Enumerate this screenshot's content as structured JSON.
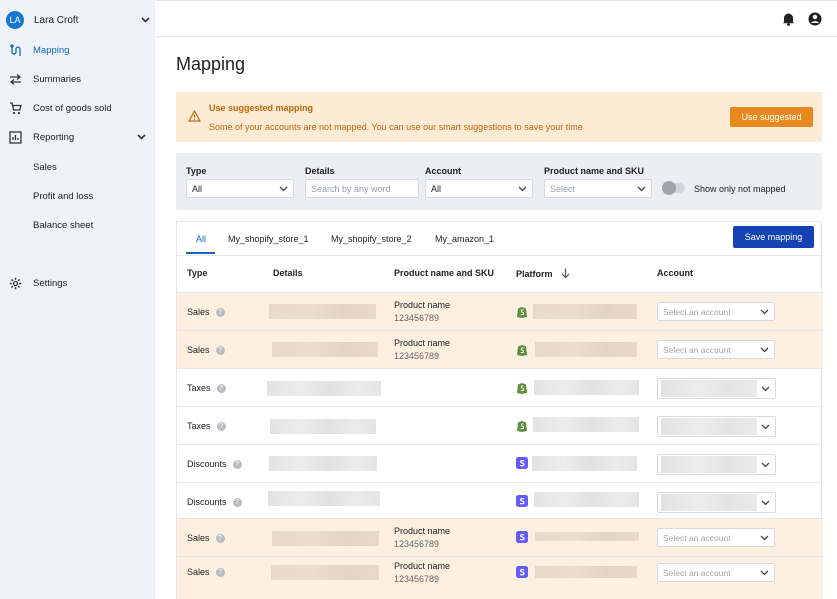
{
  "user": {
    "initials": "LA",
    "name": "Lara Croft"
  },
  "nav": {
    "mapping": "Mapping",
    "summaries": "Summaries",
    "cogs": "Cost of goods sold",
    "reporting": "Reporting",
    "sub": [
      "Sales",
      "Profit and loss",
      "Balance sheet"
    ],
    "settings": "Settings"
  },
  "page": {
    "title": "Mapping"
  },
  "banner": {
    "title": "Use suggested mapping",
    "text": "Some of your accounts are not mapped. You can use our smart suggestions to save your time",
    "button": "Use suggested"
  },
  "filters": {
    "type": {
      "label": "Type",
      "value": "All"
    },
    "details": {
      "label": "Details",
      "placeholder": "Search by any word"
    },
    "account": {
      "label": "Account",
      "value": "All"
    },
    "product": {
      "label": "Product name and SKU",
      "placeholder": "Select"
    },
    "toggle_label": "Show only not mapped"
  },
  "tabs": [
    "All",
    "My_shopify_store_1",
    "My_shopify_store_2",
    "My_amazon_1"
  ],
  "save_button": "Save mapping",
  "columns": {
    "type": "Type",
    "details": "Details",
    "product": "Product name and SKU",
    "platform": "Platform",
    "account": "Account"
  },
  "rows": [
    {
      "type": "Sales",
      "product_name": "Product name",
      "sku": "123456789",
      "platform": "shopify",
      "account_placeholder": "Select an account",
      "highlight": true
    },
    {
      "type": "Sales",
      "product_name": "Product name",
      "sku": "123456789",
      "platform": "shopify",
      "account_placeholder": "Select an account",
      "highlight": true
    },
    {
      "type": "Taxes",
      "platform": "shopify",
      "highlight": false
    },
    {
      "type": "Taxes",
      "platform": "shopify",
      "highlight": false
    },
    {
      "type": "Discounts",
      "platform": "stripe",
      "highlight": false
    },
    {
      "type": "Discounts",
      "platform": "stripe",
      "highlight": false
    },
    {
      "type": "Sales",
      "product_name": "Product name",
      "sku": "123456789",
      "platform": "stripe",
      "account_placeholder": "Select an account",
      "highlight": true
    },
    {
      "type": "Sales",
      "product_name": "Product name",
      "sku": "123456789",
      "platform": "stripe",
      "account_placeholder": "Select an account",
      "highlight": true
    }
  ],
  "colors": {
    "primary": "#1543b4",
    "accent_orange": "#e8891e",
    "banner_bg": "#fdebd6",
    "row_highlight": "#fdf0e1",
    "shopify_green": "#5e8e3e",
    "stripe_purple": "#635bff"
  }
}
